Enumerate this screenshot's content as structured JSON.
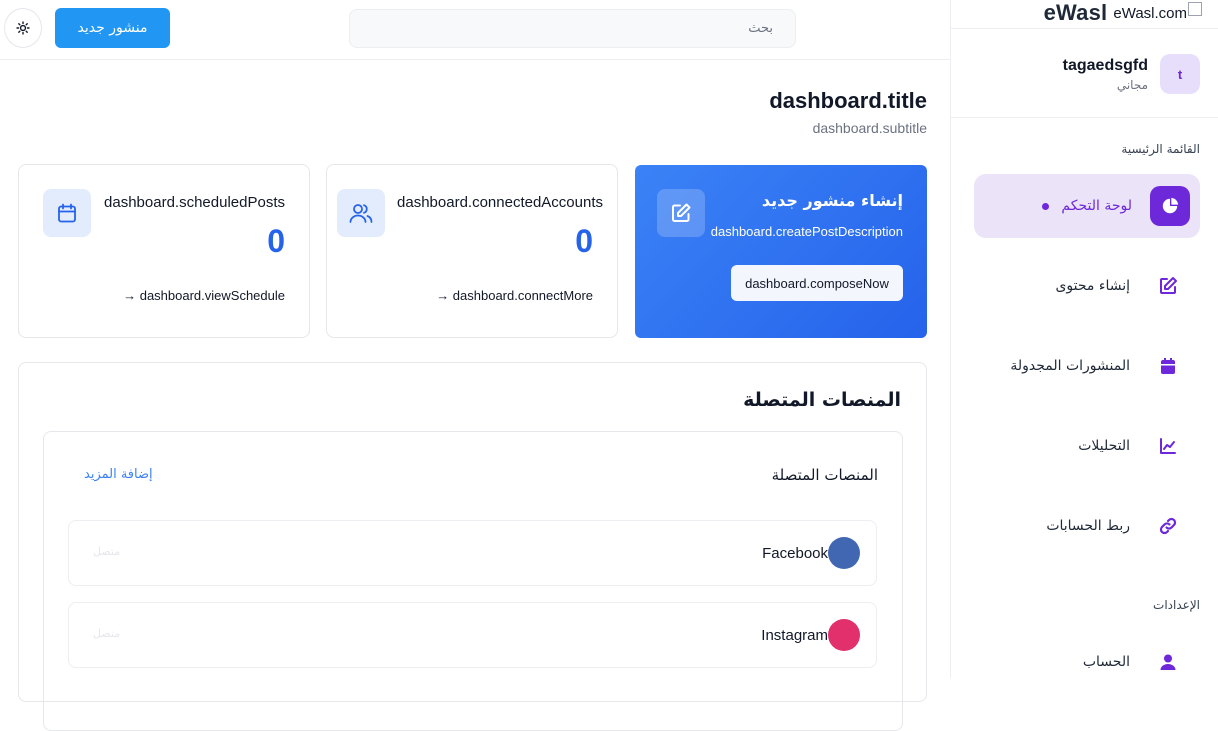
{
  "sidebar": {
    "logo_text": "eWasl",
    "logo_img_alt": "eWasl.com",
    "user": {
      "initial": "t",
      "name": "tagaedsgfd",
      "plan": "مجاني"
    },
    "main_menu_label": "القائمة الرئيسية",
    "settings_label": "الإعدادات",
    "items": [
      {
        "label": "لوحة التحكم",
        "icon": "pie-chart-icon",
        "active": true
      },
      {
        "label": "إنشاء محتوى",
        "icon": "edit-icon"
      },
      {
        "label": "المنشورات المجدولة",
        "icon": "calendar-icon"
      },
      {
        "label": "التحليلات",
        "icon": "line-chart-icon"
      },
      {
        "label": "ربط الحسابات",
        "icon": "link-icon"
      }
    ],
    "settings_items": [
      {
        "label": "الحساب",
        "icon": "user-icon"
      }
    ]
  },
  "topbar": {
    "new_post_label": "منشور جديد",
    "search_placeholder": "بحث",
    "theme_icon": "sun-icon"
  },
  "dashboard": {
    "title": "dashboard.title",
    "subtitle": "dashboard.subtitle",
    "cards": [
      {
        "title": "dashboard.scheduledPosts",
        "value": "0",
        "link": "→ dashboard.viewSchedule",
        "icon": "calendar-icon"
      },
      {
        "title": "dashboard.connectedAccounts",
        "value": "0",
        "link": "→ dashboard.connectMore",
        "icon": "users-icon"
      }
    ],
    "cta": {
      "title": "إنشاء منشور جديد",
      "description": "dashboard.createPostDescription",
      "button": "dashboard.composeNow",
      "icon": "edit-icon"
    }
  },
  "platforms": {
    "panel_title": "المنصات المتصلة",
    "inner_title": "المنصات المتصلة",
    "add_more": "إضافة المزيد",
    "items": [
      {
        "name": "Facebook",
        "status": "متصل",
        "color": "#4267b2"
      },
      {
        "name": "Instagram",
        "status": "متصل",
        "color": "#e1306c"
      }
    ]
  },
  "colors": {
    "accent": "#6d28d9",
    "primary": "#2563eb",
    "button": "#2196f3"
  }
}
